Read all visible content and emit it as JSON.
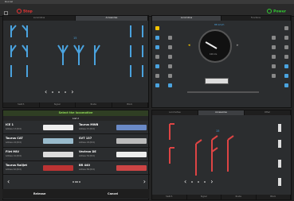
{
  "window": {
    "title": "Rocrail"
  },
  "topbar": {
    "stop_label": "Stop",
    "power_label": "Power"
  },
  "left_panel": {
    "tabs": [
      "Locomotive",
      "Accessories"
    ],
    "footer_tabs": [
      "Switch",
      "Signal",
      "Route",
      "Block"
    ],
    "pager_value": "15"
  },
  "right_panel": {
    "tabs": [
      "Locomotive",
      "Functions"
    ],
    "speed_label": "88 km/h",
    "speed_value": "100 ms"
  },
  "loco_list": {
    "header": "Select the locomotive",
    "list_label": "List 2",
    "locos": [
      {
        "name": "ICE 1",
        "address": "Address: 13 (DCC)"
      },
      {
        "name": "Taurus MWB",
        "address": "Address: 15 (DCC)"
      },
      {
        "name": "Taurus CAT",
        "address": "Address: 24 (DCC)"
      },
      {
        "name": "SVT 137",
        "address": "Address: 29 (DCC)"
      },
      {
        "name": "Flirt MIV",
        "address": "Address: 41 (DCC)"
      },
      {
        "name": "Vectron DE",
        "address": "Address: 56 (DCC)"
      },
      {
        "name": "Taurus Railjet",
        "address": "Address: 62 (DCC)"
      },
      {
        "name": "BR 440",
        "address": "Address: 89 (DCC)"
      }
    ],
    "release_label": "Release",
    "cancel_label": "Cancel"
  },
  "signals_panel": {
    "tabs": [
      "Locomotive",
      "Accessories",
      "Other"
    ],
    "footer_tabs": [
      "Switch",
      "Signal",
      "Route",
      "Block"
    ],
    "pager_value": "15"
  },
  "colors": {
    "accent_blue": "#4aa3df",
    "stop_red": "#e33333",
    "power_green": "#33cc33",
    "header_green": "#8fd657"
  }
}
